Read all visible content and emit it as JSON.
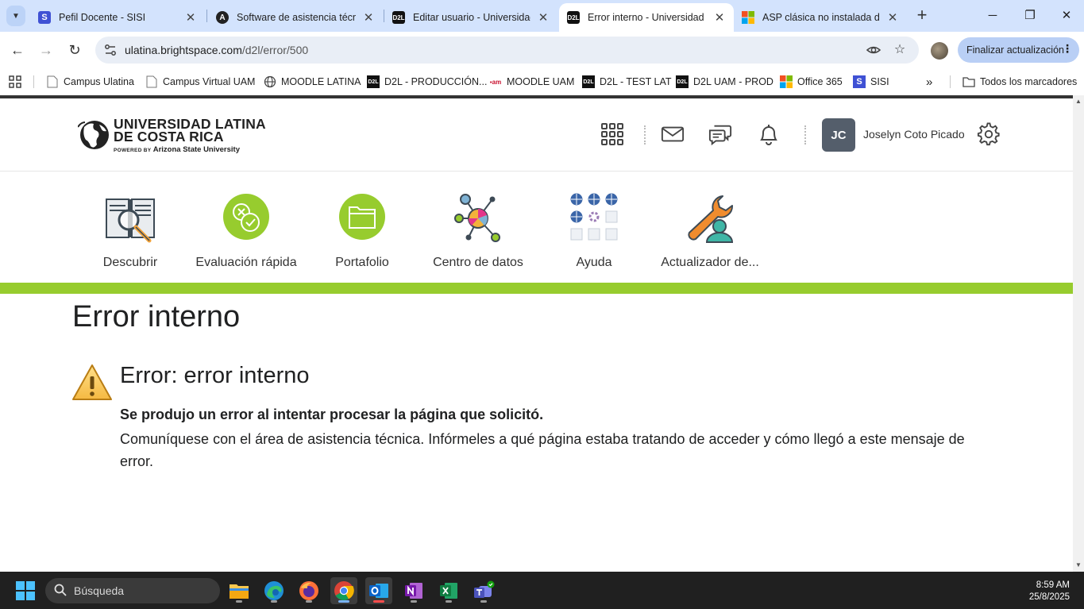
{
  "browser": {
    "tabs": [
      {
        "title": "Pefil Docente - SISI",
        "favicon": "sisi-icon",
        "active": false
      },
      {
        "title": "Software de asistencia técnica",
        "favicon": "assist-icon",
        "active": false
      },
      {
        "title": "Editar usuario - Universidad",
        "favicon": "d2l-icon",
        "active": false
      },
      {
        "title": "Error interno - Universidad L",
        "favicon": "d2l-icon",
        "active": true
      },
      {
        "title": "ASP clásica no instalada de f",
        "favicon": "microsoft-icon",
        "active": false
      }
    ],
    "close_glyph": "✕",
    "address": {
      "host": "ulatina.brightspace.com",
      "path": "/d2l/error/500"
    },
    "update_button": "Finalizar actualización",
    "bookmarks": [
      {
        "label": "Campus  Ulatina",
        "icon": "page-icon"
      },
      {
        "label": "Campus Virtual UAM",
        "icon": "page-icon"
      },
      {
        "label": "MOODLE LATINA",
        "icon": "globe-icon"
      },
      {
        "label": "D2L - PRODUCCIÓN...",
        "icon": "d2l-icon"
      },
      {
        "label": "MOODLE UAM",
        "icon": "uam-icon"
      },
      {
        "label": "D2L - TEST LAT",
        "icon": "d2l-icon"
      },
      {
        "label": "D2L UAM - PROD",
        "icon": "d2l-icon"
      },
      {
        "label": "Office 365",
        "icon": "microsoft-icon"
      },
      {
        "label": "SISI",
        "icon": "sisi-icon"
      }
    ],
    "bookmarks_overflow": "»",
    "all_bookmarks": "Todos los marcadores"
  },
  "site": {
    "logo": {
      "line1": "UNIVERSIDAD LATINA",
      "line2": "DE COSTA RICA",
      "powered_by": "POWERED BY",
      "partner": "Arizona State University"
    },
    "user": {
      "initials": "JC",
      "name": "Joselyn Coto Picado"
    },
    "nav": [
      {
        "label": "Descubrir",
        "icon": "book-magnifier-icon"
      },
      {
        "label": "Evaluación rápida",
        "icon": "quick-eval-icon"
      },
      {
        "label": "Portafolio",
        "icon": "portfolio-folder-icon"
      },
      {
        "label": "Centro de datos",
        "icon": "data-hub-icon"
      },
      {
        "label": "Ayuda",
        "icon": "help-grid-icon"
      },
      {
        "label": "Actualizador de...",
        "icon": "wrench-user-icon"
      }
    ],
    "accent_color": "#97cc2e"
  },
  "error": {
    "page_title": "Error interno",
    "heading": "Error: error interno",
    "bold_message": "Se produjo un error al intentar procesar la página que solicitó.",
    "message": "Comuníquese con el área de asistencia técnica. Infórmeles a qué página estaba tratando de acceder y cómo llegó a este mensaje de error."
  },
  "taskbar": {
    "search_placeholder": "Búsqueda",
    "apps": [
      "file-explorer-icon",
      "edge-icon",
      "firefox-icon",
      "chrome-icon",
      "outlook-icon",
      "onenote-icon",
      "excel-icon",
      "teams-icon"
    ],
    "time": "8:59 AM",
    "date": "25/8/2025"
  }
}
